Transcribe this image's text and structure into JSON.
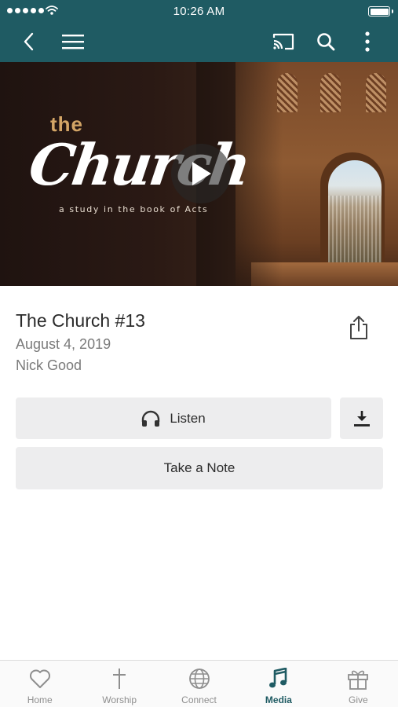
{
  "status_bar": {
    "time": "10:26 AM"
  },
  "nav": {
    "back_icon": "chevron-left-icon",
    "menu_icon": "hamburger-icon",
    "cast_icon": "cast-icon",
    "search_icon": "search-icon",
    "more_icon": "more-vertical-icon",
    "color": "#1f5b63"
  },
  "hero": {
    "title_small": "the",
    "title_script": "Church",
    "tagline": "a study in the book of Acts",
    "play_icon": "play-icon"
  },
  "media": {
    "title": "The Church #13",
    "date": "August 4, 2019",
    "speaker": "Nick Good"
  },
  "actions": {
    "listen_label": "Listen",
    "note_label": "Take a Note",
    "share_icon": "share-icon",
    "download_icon": "download-icon",
    "headphones_icon": "headphones-icon"
  },
  "tabs": [
    {
      "label": "Home",
      "icon": "heart-icon",
      "active": false
    },
    {
      "label": "Worship",
      "icon": "cross-icon",
      "active": false
    },
    {
      "label": "Connect",
      "icon": "globe-icon",
      "active": false
    },
    {
      "label": "Media",
      "icon": "music-note-icon",
      "active": true
    },
    {
      "label": "Give",
      "icon": "gift-icon",
      "active": false
    }
  ],
  "colors": {
    "accent": "#1f5b63",
    "button_bg": "#ededee",
    "inactive_tab": "#8e8e8e"
  }
}
